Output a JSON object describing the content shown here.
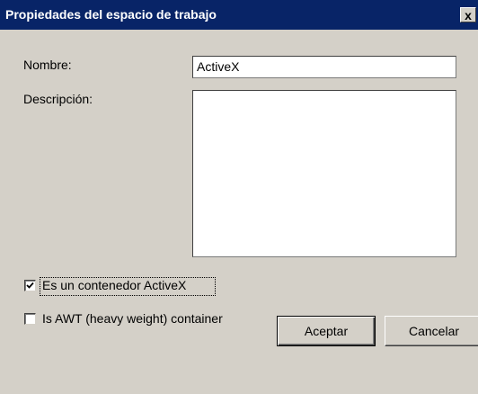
{
  "dialog": {
    "title": "Propiedades del espacio de trabajo",
    "close_glyph": "x"
  },
  "form": {
    "name_label": "Nombre:",
    "name_value": "ActiveX",
    "description_label": "Descripción:",
    "description_value": ""
  },
  "options": {
    "activex_label": "Es un contenedor ActiveX",
    "activex_checked": true,
    "awt_label": "Is AWT (heavy weight) container",
    "awt_checked": false
  },
  "buttons": {
    "accept_label": "Aceptar",
    "cancel_label": "Cancelar"
  },
  "colors": {
    "titlebar": "#082467",
    "dialog_bg": "#d4d0c8"
  }
}
